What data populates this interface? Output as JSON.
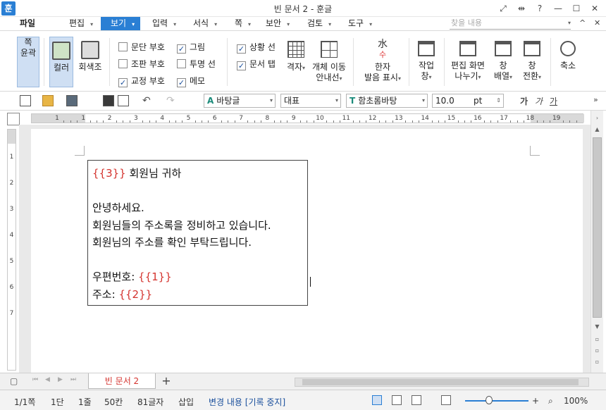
{
  "window": {
    "app_icon": "훈",
    "title": "빈 문서 2 - 훈글",
    "controls": [
      "⤢",
      "⇹",
      "?",
      "—",
      "☐",
      "✕"
    ]
  },
  "menu": {
    "items": [
      "파일",
      "편집",
      "보기",
      "입력",
      "서식",
      "쪽",
      "보안",
      "검토",
      "도구"
    ],
    "active": "보기",
    "search_placeholder": "찾을 내용",
    "right_controls": [
      "^",
      "✕"
    ]
  },
  "ribbon": {
    "outline": "쪽\n윤곽",
    "color": "컬러",
    "gray": "회색조",
    "checks": [
      {
        "label": "문단 부호",
        "checked": false
      },
      {
        "label": "조판 부호",
        "checked": false
      },
      {
        "label": "교정 부호",
        "checked": true
      },
      {
        "label": "그림",
        "checked": true
      },
      {
        "label": "투명 선",
        "checked": false
      },
      {
        "label": "메모",
        "checked": true
      },
      {
        "label": "상황 선",
        "checked": true
      },
      {
        "label": "문서 탭",
        "checked": true
      }
    ],
    "grid": "격자",
    "object_move_1": "개체 이동",
    "object_move_2": "안내선",
    "hanja_1": "한자",
    "hanja_2": "발음 표시",
    "task_1": "작업",
    "task_2": "창",
    "split_1": "편집 화면",
    "split_2": "나누기",
    "arrange_1": "창",
    "arrange_2": "배열",
    "switch_1": "창",
    "switch_2": "전환",
    "zoom": "축소"
  },
  "toolbar": {
    "style": "바탕글",
    "lang": "대표",
    "font": "함초롬바탕",
    "size": "10.0",
    "unit": "pt",
    "fmt1": "가",
    "fmt2": "가",
    "fmt3": "가"
  },
  "ruler": {
    "numbers": [
      "1",
      "1",
      "2",
      "3",
      "4",
      "5",
      "6",
      "7",
      "8",
      "9",
      "10",
      "11",
      "12",
      "13",
      "14",
      "15",
      "16",
      "17",
      "18",
      "19"
    ],
    "vnumbers": [
      "1",
      "2",
      "3",
      "4",
      "5",
      "6",
      "7"
    ]
  },
  "document": {
    "lines": [
      {
        "field": "{{3}}",
        "text": " 회원님 귀하"
      },
      {
        "field": "",
        "text": ""
      },
      {
        "field": "",
        "text": "안녕하세요."
      },
      {
        "field": "",
        "text": "회원님들의 주소록을 정비하고 있습니다."
      },
      {
        "field": "",
        "text": "회원님의 주소를 확인 부탁드립니다."
      },
      {
        "field": "",
        "text": ""
      },
      {
        "field": "{{1}}",
        "text": "우편번호: "
      },
      {
        "field": "{{2}}",
        "text": "주소: "
      }
    ]
  },
  "tabs": {
    "doc_tab": "빈 문서 2",
    "add": "+"
  },
  "status": {
    "page": "1/1쪽",
    "section": "1단",
    "line": "1줄",
    "col": "50칸",
    "chars": "81글자",
    "mode": "삽입",
    "track": "변경 내용 [기록 중지]",
    "zoom": "100%"
  }
}
